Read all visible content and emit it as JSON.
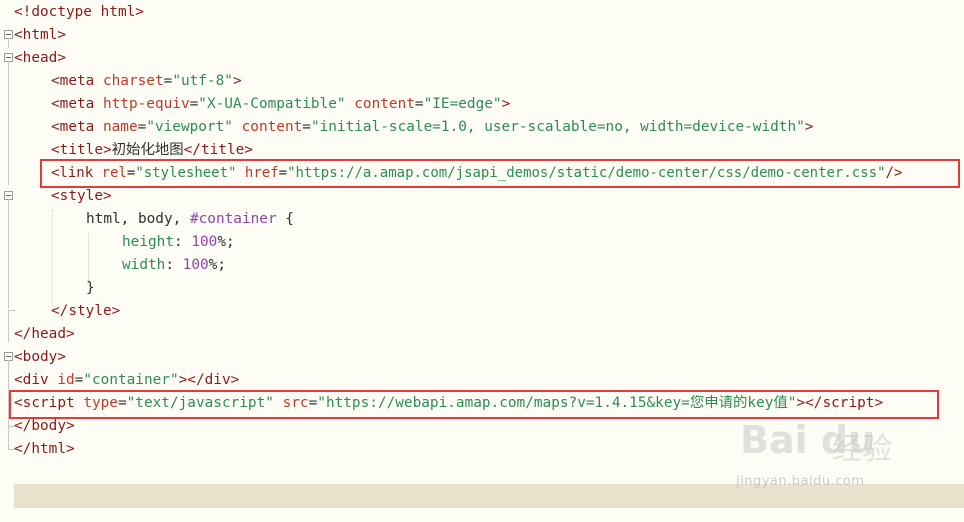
{
  "code": {
    "l1": [
      "<!doctype html>"
    ],
    "l2": [
      "<html>"
    ],
    "l3": [
      "<head>"
    ],
    "l4": [
      "<meta ",
      "charset",
      "=",
      "\"utf-8\"",
      ">"
    ],
    "l5": [
      "<meta ",
      "http-equiv",
      "=",
      "\"X-UA-Compatible\"",
      " ",
      "content",
      "=",
      "\"IE=edge\"",
      ">"
    ],
    "l6": [
      "<meta ",
      "name",
      "=",
      "\"viewport\"",
      " ",
      "content",
      "=",
      "\"initial-scale=1.0, user-scalable=no, width=device-width\"",
      ">"
    ],
    "l7": [
      "<title>",
      "初始化地图",
      "</title>"
    ],
    "l8": [
      "<link ",
      "rel",
      "=",
      "\"stylesheet\"",
      " ",
      "href",
      "=",
      "\"https://a.amap.com/jsapi_demos/static/demo-center/css/demo-center.css\"",
      "/>"
    ],
    "l9": [
      "<style>"
    ],
    "l10": [
      "html, body, ",
      "#container",
      " {"
    ],
    "l11": [
      "height",
      ": ",
      "100",
      "%;"
    ],
    "l12": [
      "width",
      ": ",
      "100",
      "%;"
    ],
    "l13": [
      "}"
    ],
    "l14": [
      "</style>"
    ],
    "l15": [
      "</head>"
    ],
    "l16": [
      "<body>"
    ],
    "l17": [
      "<div ",
      "id",
      "=",
      "\"container\"",
      "></div>"
    ],
    "l18": [
      "<script ",
      "type",
      "=",
      "\"text/javascript\"",
      " ",
      "src",
      "=",
      "\"https://webapi.amap.com/maps?v=1.4.15&key=您申请的key值\"",
      "></",
      "script",
      ">"
    ],
    "l19": [
      "</body>"
    ],
    "l20": [
      "</html>"
    ]
  },
  "watermark": {
    "logo": "Bai du",
    "cn": "经验",
    "url": "jingyan.baidu.com"
  },
  "colors": {
    "highlight": "#e23b3b",
    "tag": "#8b1a1a",
    "attr": "#c0392b",
    "value": "#2e8b57",
    "number": "#8e44ad"
  }
}
